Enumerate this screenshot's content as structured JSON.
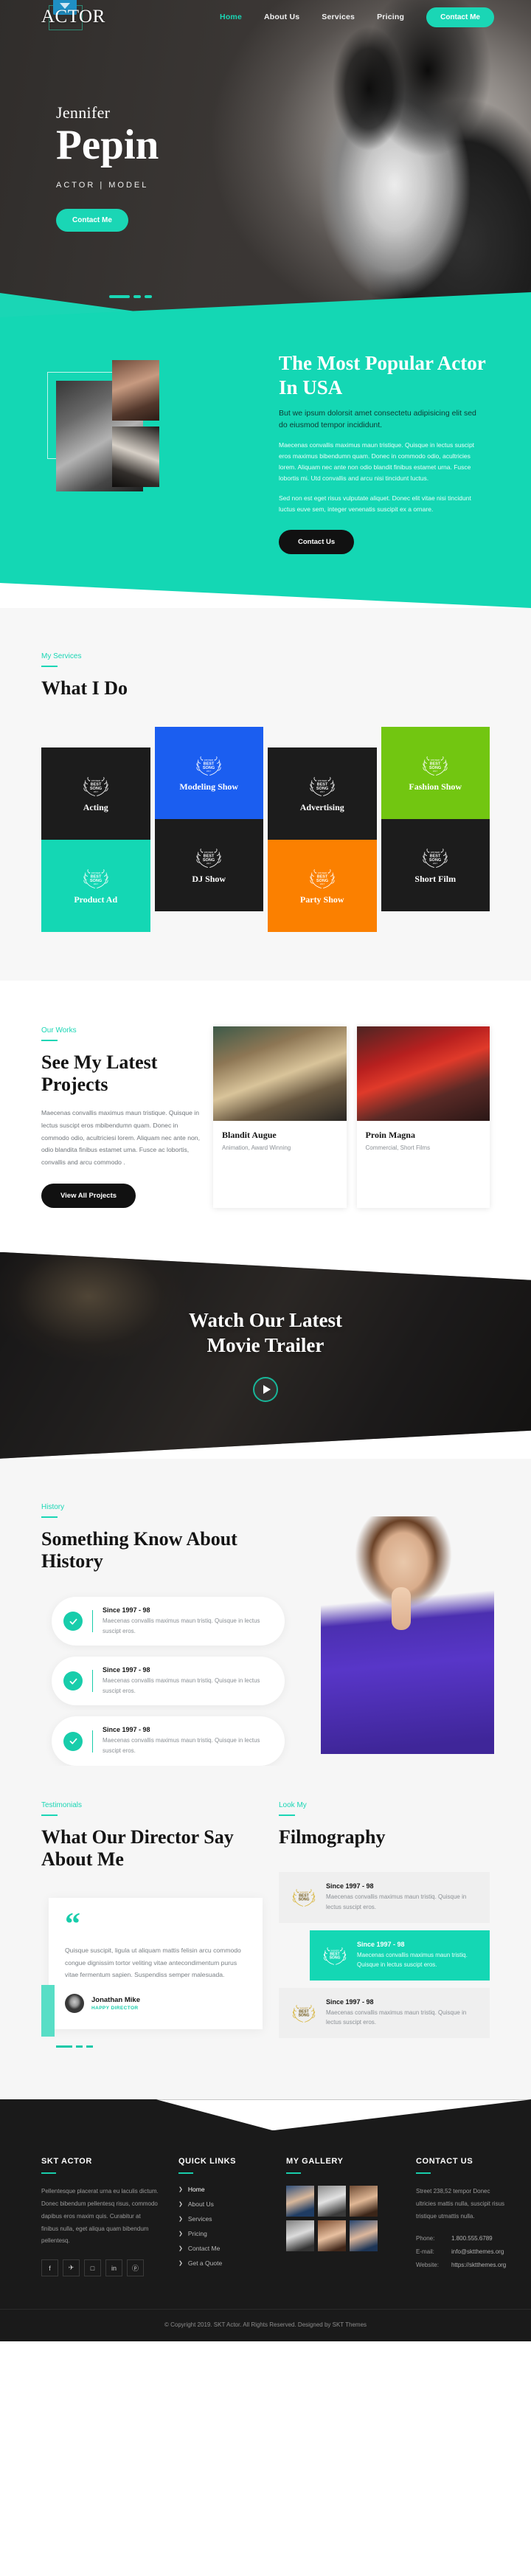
{
  "header": {
    "logo_text": "ACTOR",
    "nav": [
      {
        "label": "Home",
        "active": true
      },
      {
        "label": "About Us",
        "active": false
      },
      {
        "label": "Services",
        "active": false
      },
      {
        "label": "Pricing",
        "active": false
      }
    ],
    "cta_label": "Contact Me"
  },
  "hero": {
    "first_name": "Jennifer",
    "last_name": "Pepin",
    "role": "ACTOR  |  MODEL",
    "cta_label": "Contact Me"
  },
  "popular": {
    "title": "The Most Popular Actor In USA",
    "lead": "But we ipsum dolorsit amet consectetu adipisicing elit sed do eiusmod tempor incididunt.",
    "paragraph1": "Maecenas convallis maximus maun tristique. Quisque in lectus suscipt eros maximus bibendumn quam. Donec in commodo odio, acultricies lorem. Aliquam nec ante non odio blandit finibus estamet urna. Fusce lobortis mi. Utd convallis and arcu nisi tincidunt luctus.",
    "paragraph2": "Sed non est eget risus vulputate aliquet. Donec elit vitae nisi tincidunt luctus euve sem, integer venenatis suscipit ex a ornare.",
    "cta_label": "Contact Us"
  },
  "services": {
    "eyebrow": "My Services",
    "title": "What I Do",
    "columns": [
      [
        {
          "label": "Acting",
          "color": "bg-dark"
        },
        {
          "label": "Product Ad",
          "color": "bg-teal"
        }
      ],
      [
        {
          "label": "Modeling Show",
          "color": "bg-blue"
        },
        {
          "label": "DJ Show",
          "color": "bg-dark"
        }
      ],
      [
        {
          "label": "Advertising",
          "color": "bg-dark"
        },
        {
          "label": "Party Show",
          "color": "bg-orange"
        }
      ],
      [
        {
          "label": "Fashion Show",
          "color": "bg-green"
        },
        {
          "label": "Short Film",
          "color": "bg-dark"
        }
      ]
    ]
  },
  "works": {
    "eyebrow": "Our Works",
    "title": "See My Latest Projects",
    "body": "Maecenas convallis maximus maun tristique. Quisque in lectus suscipt eros mbibendumn quam. Donec in commodo odio, acultriciesi lorem. Aliquam nec ante non, odio blandita finibus estamet uma. Fusce ac lobortis, convallis and arcu commodo .",
    "cta_label": "View All Projects",
    "projects": [
      {
        "title": "Blandit Augue",
        "subtitle": "Animation, Award Winning",
        "thumb": "pt1"
      },
      {
        "title": "Proin Magna",
        "subtitle": "Commercial, Short Films",
        "thumb": "pt2"
      }
    ]
  },
  "trailer": {
    "title_line1": "Watch Our Latest",
    "title_line2": "Movie Trailer"
  },
  "history": {
    "eyebrow": "History",
    "title": "Something Know About History",
    "items": [
      {
        "heading": "Since 1997 - 98",
        "text": "Maecenas convallis maximus maun tristiq. Quisque in lectus suscipt eros."
      },
      {
        "heading": "Since 1997 - 98",
        "text": "Maecenas convallis maximus maun tristiq. Quisque in lectus suscipt eros."
      },
      {
        "heading": "Since 1997 - 98",
        "text": "Maecenas convallis maximus maun tristiq. Quisque in lectus suscipt eros."
      }
    ]
  },
  "testimonials": {
    "eyebrow": "Testimonials",
    "title": "What Our Director Say About Me",
    "quote": "Quisque suscipit, ligula ut aliquam mattis felisin arcu commodo congue dignissim tortor veliting vitae antecondimentum purus vitae fermentum sapien. Suspendiss semper malesuada.",
    "author_name": "Jonathan Mike",
    "author_role": "HAPPY DIRECTOR"
  },
  "filmography": {
    "eyebrow": "Look My",
    "title": "Filmography",
    "items": [
      {
        "heading": "Since 1997 - 98",
        "text": "Maecenas convallis maximus maun tristiq. Quisque in lectus suscipt eros.",
        "active": false
      },
      {
        "heading": "Since 1997 - 98",
        "text": "Maecenas convallis maximus maun tristiq. Quisque in lectus suscipt eros.",
        "active": true
      },
      {
        "heading": "Since 1997 - 98",
        "text": "Maecenas convallis maximus maun tristiq. Quisque in lectus suscipt eros.",
        "active": false
      }
    ]
  },
  "footer": {
    "about": {
      "heading": "SKT ACTOR",
      "text": "Pellentesque placerat urna eu laculis dictum. Donec bibendum pellentesq risus, commodo dapibus eros maxim quis. Curabitur at finibus nulla, eget aliqua quam bibendum pellentesq.",
      "socials": [
        {
          "icon": "facebook-icon",
          "glyph": "f"
        },
        {
          "icon": "twitter-icon",
          "glyph": "✈"
        },
        {
          "icon": "instagram-icon",
          "glyph": "□"
        },
        {
          "icon": "linkedin-icon",
          "glyph": "in"
        },
        {
          "icon": "pinterest-icon",
          "glyph": "ⓟ"
        }
      ]
    },
    "quick_links": {
      "heading": "QUICK LINKS",
      "links": [
        {
          "label": "Home",
          "active": true
        },
        {
          "label": "About Us",
          "active": false
        },
        {
          "label": "Services",
          "active": false
        },
        {
          "label": "Pricing",
          "active": false
        },
        {
          "label": "Contact Me",
          "active": false
        },
        {
          "label": "Get a Quote",
          "active": false
        }
      ]
    },
    "gallery": {
      "heading": "MY GALLERY",
      "thumbs": [
        "g1",
        "g2",
        "g3",
        "g4",
        "g5",
        "g6"
      ]
    },
    "contact": {
      "heading": "CONTACT US",
      "address": "Street 238,52 tempor Donec ultricies mattis nulla, suscipit risus tristique utmattis nulla.",
      "rows": [
        {
          "key": "Phone:",
          "value": "1.800.555.6789"
        },
        {
          "key": "E-mail:",
          "value": "info@sktthemes.org"
        },
        {
          "key": "Website:",
          "value": "https://sktthemes.org"
        }
      ]
    },
    "copyright": "© Copyright 2019. SKT Actor. All Rights Reserved. Designed by SKT Themes"
  }
}
